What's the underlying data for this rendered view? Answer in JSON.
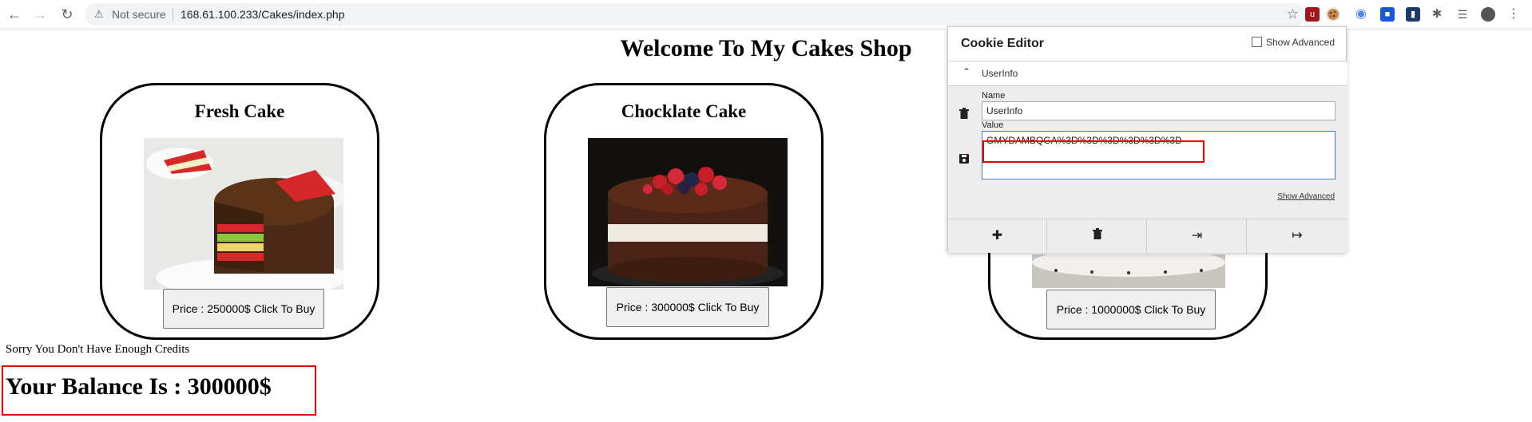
{
  "browser": {
    "security_text": "Not secure",
    "url": "168.61.100.233/Cakes/index.php"
  },
  "page": {
    "title": "Welcome To My Cakes Shop",
    "cakes": [
      {
        "name": "Fresh Cake",
        "button": "Price : 250000$ Click To Buy"
      },
      {
        "name": "Chocklate Cake",
        "button": "Price : 300000$ Click To Buy"
      },
      {
        "name": "",
        "button": "Price : 1000000$ Click To Buy"
      }
    ],
    "message": "Sorry You Don't Have Enough Credits",
    "balance": "Your Balance Is : 300000$"
  },
  "cookie_editor": {
    "title": "Cookie Editor",
    "show_advanced_checkbox": "Show Advanced",
    "cookie_name": "UserInfo",
    "name_label": "Name",
    "name_value": "UserInfo",
    "value_label": "Value",
    "value": "GMYDAMBQGA%3D%3D%3D%3D%3D%3D",
    "show_advanced_link": "Show Advanced"
  },
  "colors": {
    "highlight": "#ee0000",
    "omnibox_bg": "#f1f3f4"
  }
}
